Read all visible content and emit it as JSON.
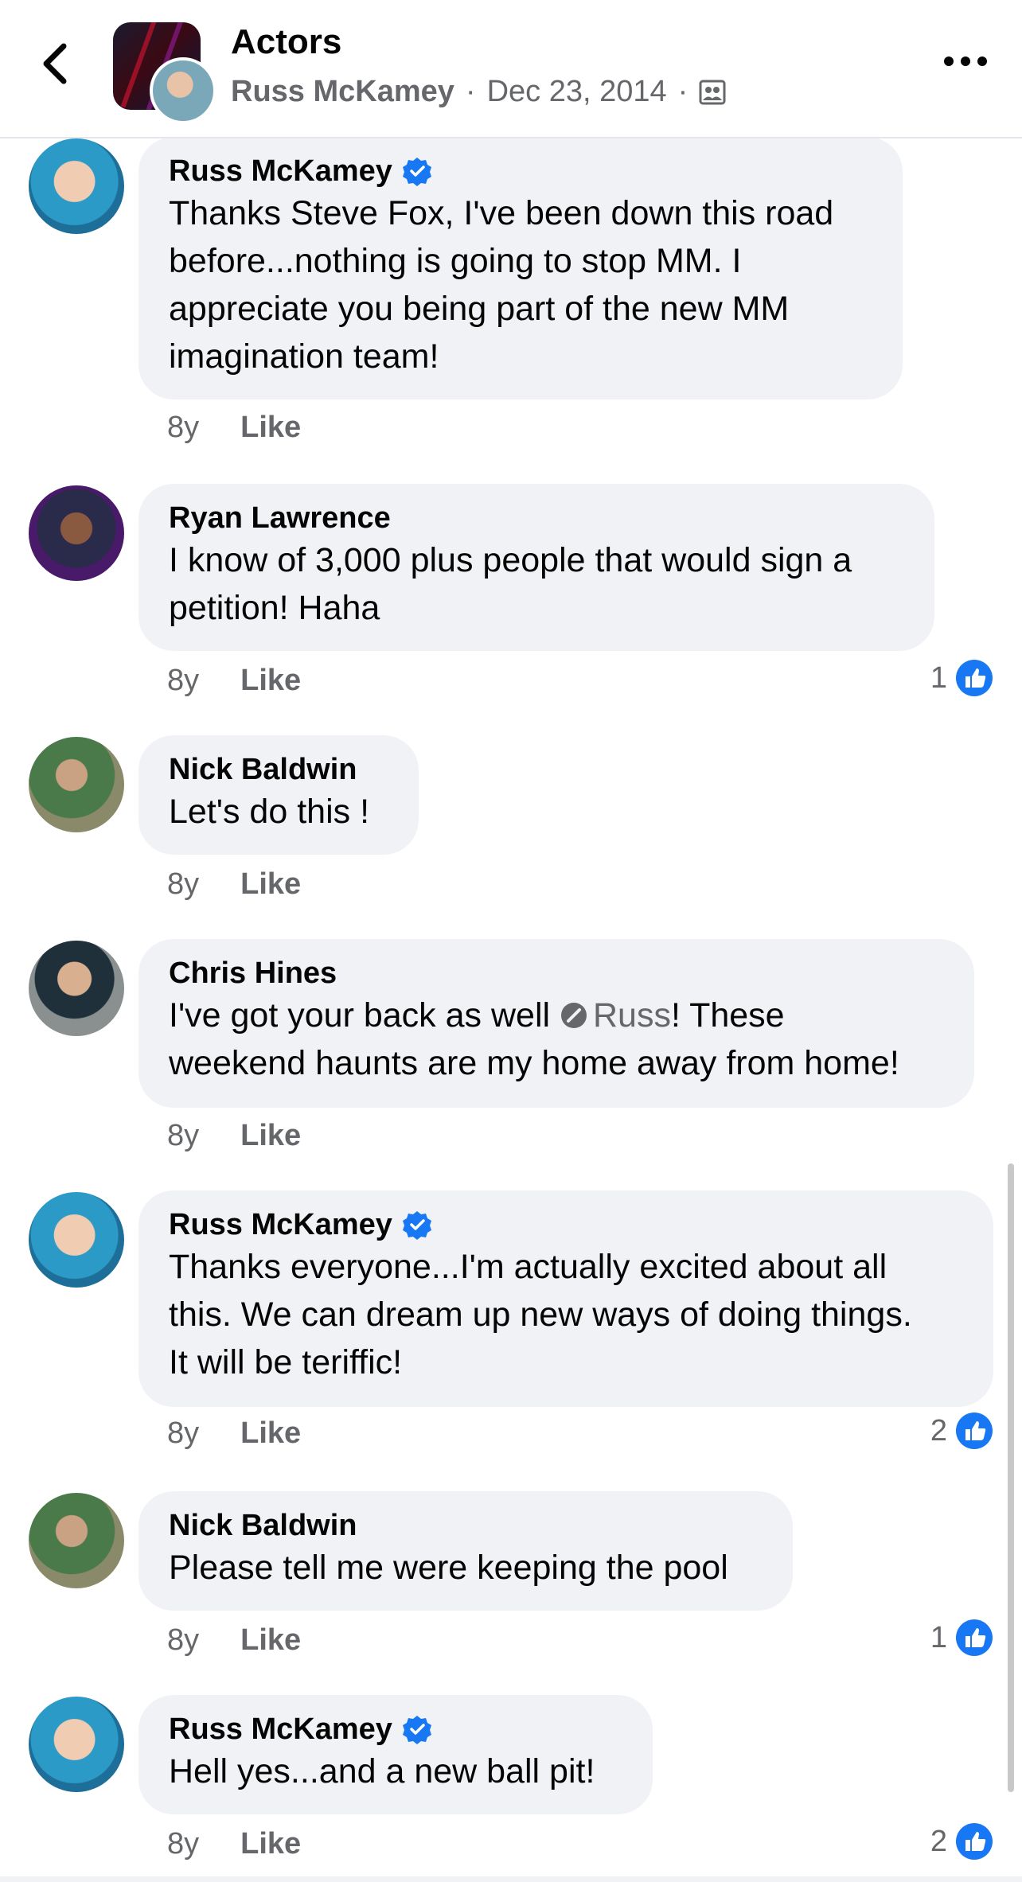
{
  "header": {
    "title": "Actors",
    "author": "Russ McKamey",
    "sep1": "·",
    "date": "Dec 23, 2014",
    "sep2": "·",
    "privacy_icon": "group-privacy-icon",
    "back_icon": "chevron-left-icon",
    "more_icon": "more-dots-icon"
  },
  "comments": [
    {
      "name": "Russ McKamey",
      "verified": true,
      "text": "Thanks Steve Fox, I've been down this road\nbefore...nothing is going to stop MM. I\nappreciate you being part of the new MM\nimagination team!",
      "age": "8y",
      "like": "Like",
      "reactions": ""
    },
    {
      "name": "Ryan Lawrence",
      "verified": false,
      "text": "I know of 3,000 plus people that would sign a\npetition! Haha",
      "age": "8y",
      "like": "Like",
      "reactions": "1"
    },
    {
      "name": "Nick Baldwin",
      "verified": false,
      "text": "Let's do this !",
      "age": "8y",
      "like": "Like",
      "reactions": ""
    },
    {
      "name": "Chris Hines",
      "verified": false,
      "text_before": "I've got your back as well ",
      "mention": "Russ",
      "text_after": "! These\nweekend haunts are my home away from home!",
      "age": "8y",
      "like": "Like",
      "reactions": ""
    },
    {
      "name": "Russ McKamey",
      "verified": true,
      "text": "Thanks everyone...I'm actually excited about all\nthis. We can dream up new ways of doing things.\nIt will be teriffic!",
      "age": "8y",
      "like": "Like",
      "reactions": "2"
    },
    {
      "name": "Nick Baldwin",
      "verified": false,
      "text": "Please tell me were keeping the pool",
      "age": "8y",
      "like": "Like",
      "reactions": "1"
    },
    {
      "name": "Russ McKamey",
      "verified": true,
      "text": "Hell yes...and a new ball pit!",
      "age": "8y",
      "like": "Like",
      "reactions": "2"
    }
  ],
  "colors": {
    "accent": "#1877f2",
    "bubble": "#f0f2f5",
    "secondary_text": "#65676b"
  }
}
